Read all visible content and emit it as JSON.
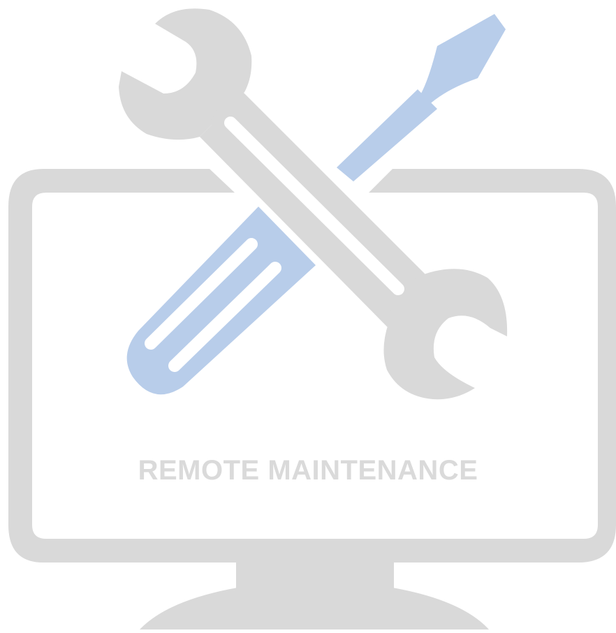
{
  "caption": "REMOTE MAINTENANCE",
  "icons": {
    "monitor": "monitor-icon",
    "wrench": "wrench-icon",
    "screwdriver": "screwdriver-icon"
  },
  "colors": {
    "monitor": "#d9d9d9",
    "wrench": "#d9d9d9",
    "screwdriver": "#b8cdea",
    "caption": "#dadada",
    "background": "#ffffff"
  }
}
